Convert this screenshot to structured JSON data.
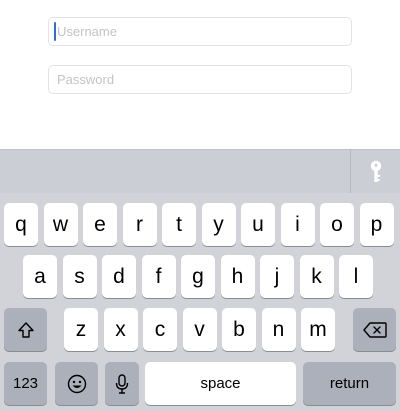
{
  "form": {
    "username_placeholder": "Username",
    "username_value": "",
    "password_placeholder": "Password",
    "password_value": ""
  },
  "accessory": {
    "icon": "key-icon"
  },
  "keyboard": {
    "row1": [
      "q",
      "w",
      "e",
      "r",
      "t",
      "y",
      "u",
      "i",
      "o",
      "p"
    ],
    "row2": [
      "a",
      "s",
      "d",
      "f",
      "g",
      "h",
      "j",
      "k",
      "l"
    ],
    "row3": [
      "z",
      "x",
      "c",
      "v",
      "b",
      "n",
      "m"
    ],
    "shift_icon": "shift-icon",
    "delete_icon": "backspace-icon",
    "numbers_label": "123",
    "emoji_icon": "emoji-icon",
    "mic_icon": "microphone-icon",
    "space_label": "space",
    "return_label": "return"
  },
  "colors": {
    "caret": "#2f6fd6",
    "keyboard_bg": "#d1d3d9",
    "key_light": "#ffffff",
    "key_dark": "#acb0ba"
  }
}
